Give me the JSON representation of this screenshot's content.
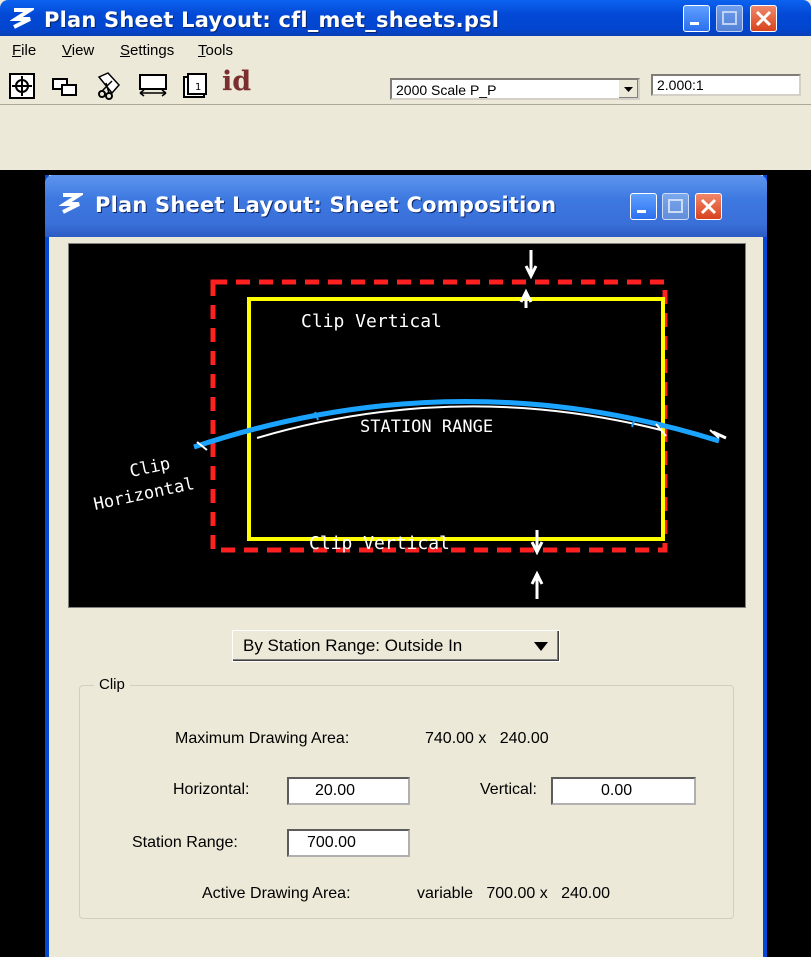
{
  "outer_window": {
    "title": "Plan Sheet Layout: cfl_met_sheets.psl",
    "menu": [
      {
        "label": "File",
        "accel": "F",
        "rest": "ile"
      },
      {
        "label": "View",
        "accel": "V",
        "rest": "iew"
      },
      {
        "label": "Settings",
        "accel": "S",
        "rest": "ettings"
      },
      {
        "label": "Tools",
        "accel": "T",
        "rest": "ools"
      }
    ],
    "toolbar": {
      "id_label": "id",
      "scale_combo": "2000 Scale P_P",
      "scale_ratio": "2.000:1"
    }
  },
  "inner_window": {
    "title": "Plan Sheet Layout: Sheet Composition",
    "diagram": {
      "clip_vertical_top": "Clip Vertical",
      "clip_vertical_bottom": "Clip Vertical",
      "station_range": "STATION RANGE",
      "clip_horizontal_1": "Clip",
      "clip_horizontal_2": "Horizontal"
    },
    "mode_dropdown": "By Station Range: Outside In",
    "clip_group": {
      "legend": "Clip",
      "max_area_label": "Maximum Drawing Area:",
      "max_area_value": "740.00 x   240.00",
      "horizontal_label": "Horizontal:",
      "horizontal_value": "20.00",
      "vertical_label": "Vertical:",
      "vertical_value": "0.00",
      "station_range_label": "Station Range:",
      "station_range_value": "700.00",
      "active_area_label": "Active Drawing Area:",
      "active_area_value": "variable   700.00 x   240.00"
    }
  },
  "colors": {
    "titlebar_active": "#0349d6",
    "window_bg": "#ece9d8",
    "clip_outline": "#ff2020",
    "sheet_outline": "#ffff00",
    "alignment": "#1aa3ff"
  }
}
